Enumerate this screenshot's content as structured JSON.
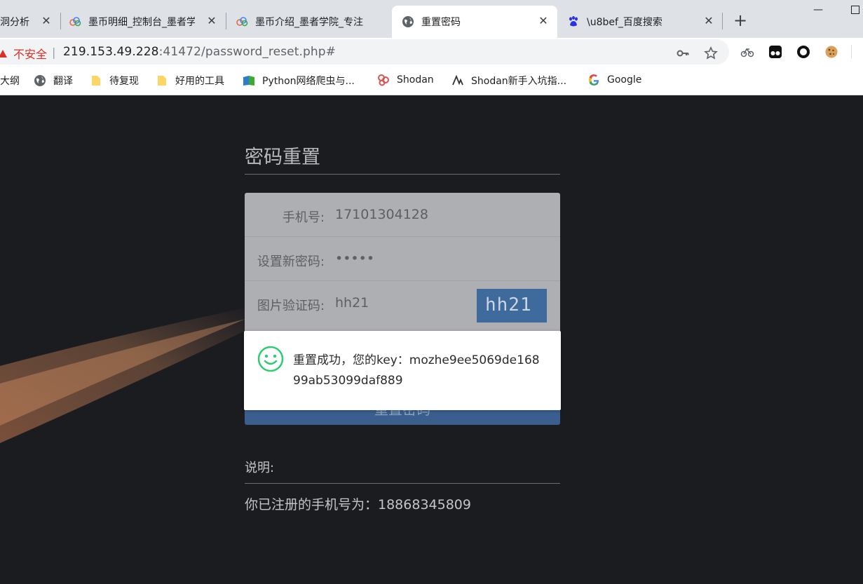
{
  "tabs": [
    {
      "title": "洞分析",
      "active": false
    },
    {
      "title": "墨币明细_控制台_墨者学院",
      "active": false
    },
    {
      "title": "墨币介绍_墨者学院_专注",
      "active": false
    },
    {
      "title": "重置密码",
      "active": true
    },
    {
      "title": "\\u8bef_百度搜索",
      "active": false
    }
  ],
  "address_bar": {
    "security_label": "不安全",
    "url_host": "219.153.49.228",
    "url_rest": ":41472/password_reset.php#"
  },
  "bookmarks": [
    {
      "label": "大纲"
    },
    {
      "label": "翻译"
    },
    {
      "label": "待复现"
    },
    {
      "label": "好用的工具"
    },
    {
      "label": "Python网络爬虫与..."
    },
    {
      "label": "Shodan"
    },
    {
      "label": "Shodan新手入坑指..."
    },
    {
      "label": "Google"
    }
  ],
  "page": {
    "title": "密码重置",
    "form": {
      "phone_label": "手机号:",
      "phone_value": "17101304128",
      "password_label": "设置新密码:",
      "password_value": "•••••",
      "captcha_label": "图片验证码:",
      "captcha_value": "hh21",
      "captcha_image_text": "hh21"
    },
    "submit_label": "重置密码",
    "toast_message": "重置成功，您的key：mozhe9ee5069de16899ab53099daf889",
    "note_title": "说明:",
    "note_text": "你已注册的手机号为：18868345809"
  },
  "colors": {
    "page_bg": "#1b1c20",
    "form_bg": "#aeafb3",
    "submit_bg": "#3a5f8f",
    "captcha_bg": "#3f6a9c",
    "warn_red": "#d93025",
    "smile_green": "#2ecc71"
  }
}
